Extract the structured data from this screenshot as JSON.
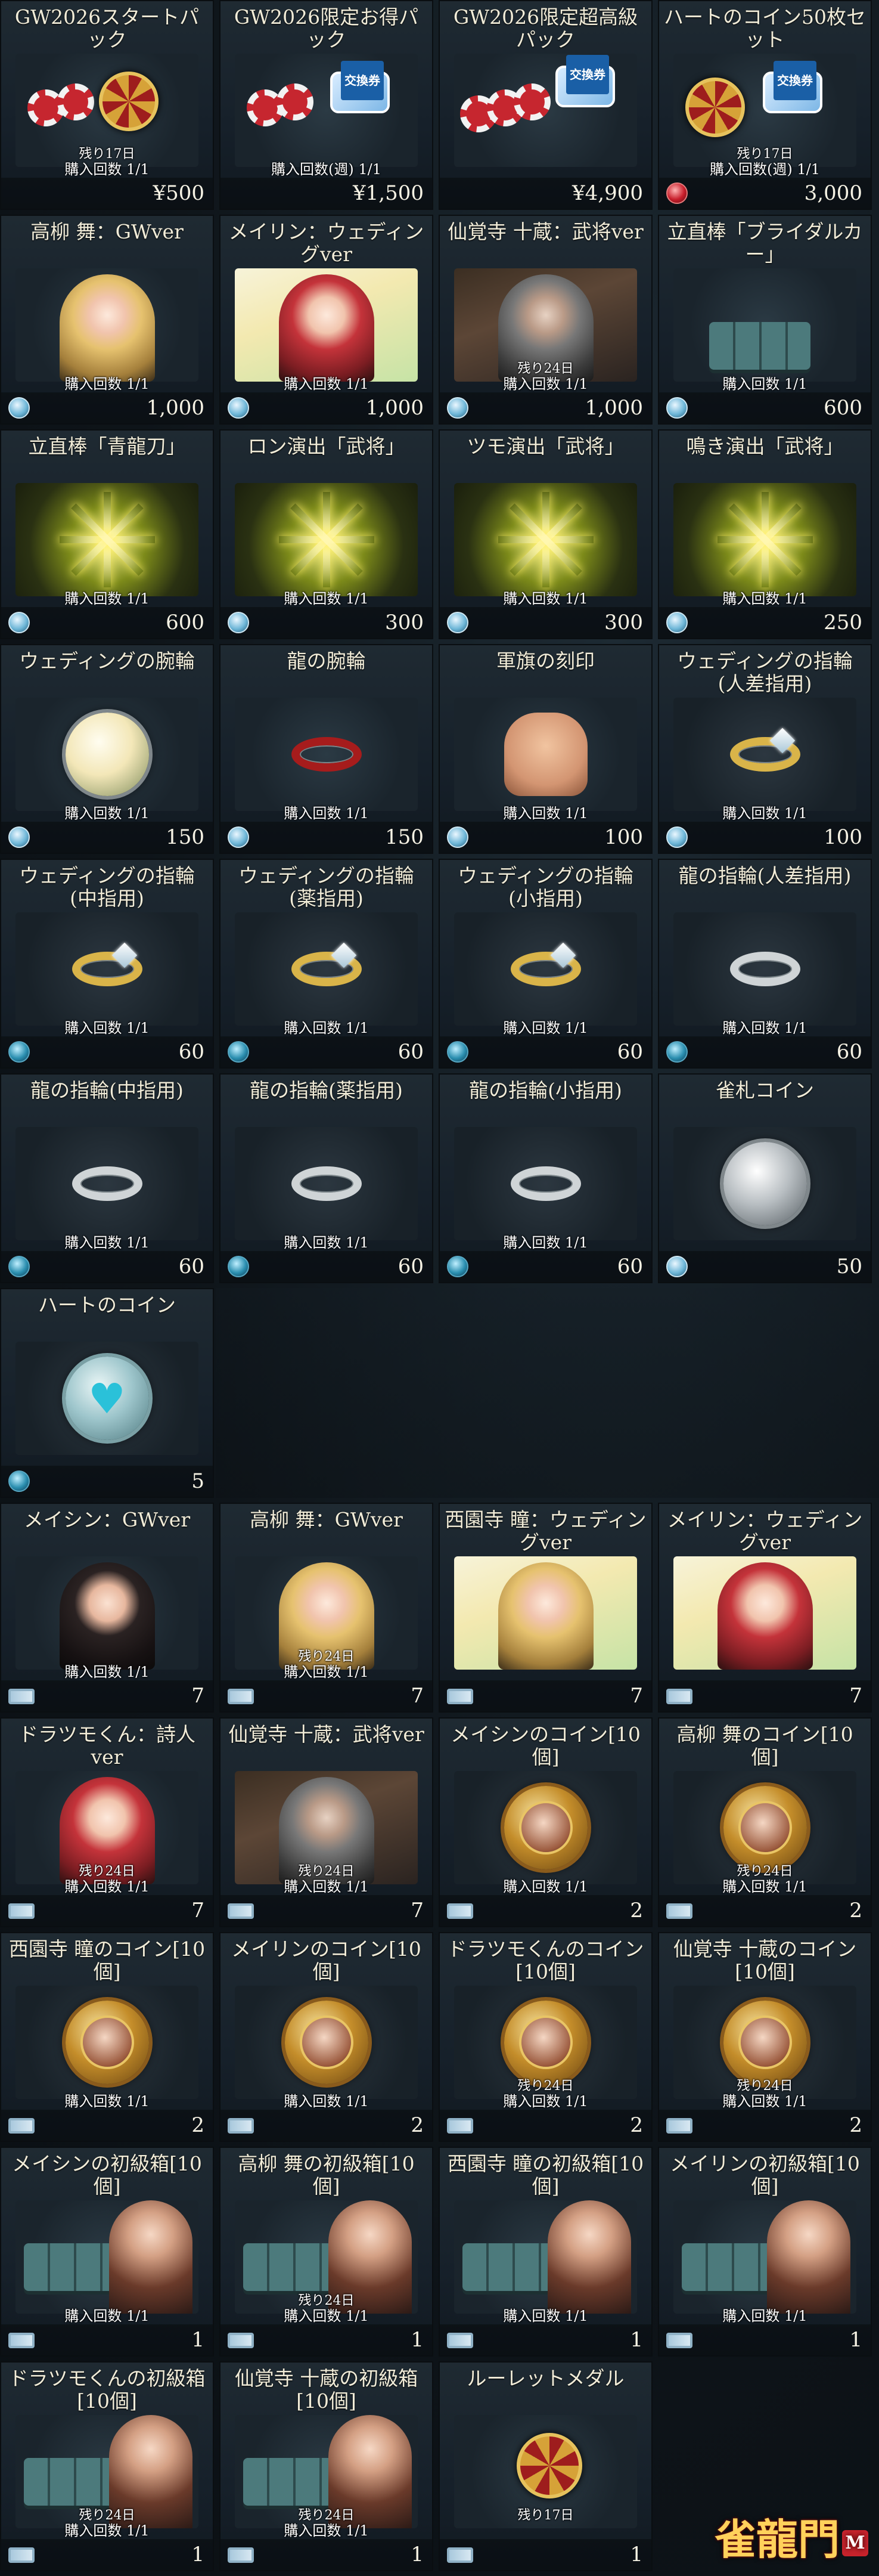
{
  "shop": {
    "cards": [
      {
        "title": "GW2026スタートパック",
        "art": "pack-start",
        "remain": "残り17日",
        "limit": "購入回数 1/1",
        "currency": "none",
        "price": "¥500"
      },
      {
        "title": "GW2026限定お得パック",
        "art": "pack-value",
        "remain": "",
        "limit": "購入回数(週) 1/1",
        "currency": "none",
        "price": "¥1,500"
      },
      {
        "title": "GW2026限定超高級パック",
        "art": "pack-premium",
        "remain": "",
        "limit": "",
        "currency": "none",
        "price": "¥4,900"
      },
      {
        "title": "ハートのコイン50枚セット",
        "art": "pack-heart",
        "remain": "残り17日",
        "limit": "購入回数(週) 1/1",
        "currency": "heart",
        "price": "3,000"
      },
      {
        "title": "高柳 舞：GWver",
        "art": "char-blonde",
        "remain": "",
        "limit": "購入回数 1/1",
        "currency": "ticket-coin",
        "price": "1,000"
      },
      {
        "title": "メイリン：ウェディングver",
        "art": "char-red-wedding",
        "remain": "",
        "limit": "購入回数 1/1",
        "currency": "ticket-coin",
        "price": "1,000"
      },
      {
        "title": "仙覚寺 十蔵：武将ver",
        "art": "char-gray",
        "remain": "残り24日",
        "limit": "購入回数 1/1",
        "currency": "ticket-coin",
        "price": "1,000"
      },
      {
        "title": "立直棒「ブライダルカー」",
        "art": "stick",
        "remain": "",
        "limit": "購入回数 1/1",
        "currency": "ticket-coin",
        "price": "600"
      },
      {
        "title": "立直棒「青龍刀」",
        "art": "effect",
        "remain": "",
        "limit": "購入回数 1/1",
        "currency": "ticket-coin",
        "price": "600"
      },
      {
        "title": "ロン演出「武将」",
        "art": "effect",
        "remain": "",
        "limit": "購入回数 1/1",
        "currency": "ticket-coin",
        "price": "300"
      },
      {
        "title": "ツモ演出「武将」",
        "art": "effect",
        "remain": "",
        "limit": "購入回数 1/1",
        "currency": "ticket-coin",
        "price": "300"
      },
      {
        "title": "鳴き演出「武将」",
        "art": "effect",
        "remain": "",
        "limit": "購入回数 1/1",
        "currency": "ticket-coin",
        "price": "250"
      },
      {
        "title": "ウェディングの腕輪",
        "art": "bouquet",
        "remain": "",
        "limit": "購入回数 1/1",
        "currency": "ticket-coin",
        "price": "150"
      },
      {
        "title": "龍の腕輪",
        "art": "bracelet",
        "remain": "",
        "limit": "購入回数 1/1",
        "currency": "ticket-coin",
        "price": "150"
      },
      {
        "title": "軍旗の刻印",
        "art": "hand",
        "remain": "",
        "limit": "購入回数 1/1",
        "currency": "ticket-coin",
        "price": "100"
      },
      {
        "title": "ウェディングの指輪(人差指用)",
        "art": "ring-gold",
        "remain": "",
        "limit": "購入回数 1/1",
        "currency": "ticket-coin",
        "price": "100"
      },
      {
        "title": "ウェディングの指輪(中指用)",
        "art": "ring-gold",
        "remain": "",
        "limit": "購入回数 1/1",
        "currency": "orb",
        "price": "60"
      },
      {
        "title": "ウェディングの指輪(薬指用)",
        "art": "ring-gold",
        "remain": "",
        "limit": "購入回数 1/1",
        "currency": "orb",
        "price": "60"
      },
      {
        "title": "ウェディングの指輪(小指用)",
        "art": "ring-gold",
        "remain": "",
        "limit": "購入回数 1/1",
        "currency": "orb",
        "price": "60"
      },
      {
        "title": "龍の指輪(人差指用)",
        "art": "ring-silver",
        "remain": "",
        "limit": "購入回数 1/1",
        "currency": "orb",
        "price": "60"
      },
      {
        "title": "龍の指輪(中指用)",
        "art": "ring-silver",
        "remain": "",
        "limit": "購入回数 1/1",
        "currency": "orb",
        "price": "60"
      },
      {
        "title": "龍の指輪(薬指用)",
        "art": "ring-silver",
        "remain": "",
        "limit": "購入回数 1/1",
        "currency": "orb",
        "price": "60"
      },
      {
        "title": "龍の指輪(小指用)",
        "art": "ring-silver",
        "remain": "",
        "limit": "購入回数 1/1",
        "currency": "orb",
        "price": "60"
      },
      {
        "title": "雀札コイン",
        "art": "coin-silver",
        "remain": "",
        "limit": "",
        "currency": "ticket-coin",
        "price": "50"
      },
      {
        "title": "ハートのコイン",
        "art": "coin-heart",
        "remain": "",
        "limit": "",
        "currency": "orb",
        "price": "5"
      }
    ],
    "ticket_cards": [
      {
        "title": "メイシン：GWver",
        "art": "char-dark",
        "remain": "",
        "limit": "購入回数 1/1",
        "price": "7"
      },
      {
        "title": "高柳 舞：GWver",
        "art": "char-blonde",
        "remain": "残り24日",
        "limit": "購入回数 1/1",
        "price": "7"
      },
      {
        "title": "西園寺 瞳：ウェディングver",
        "art": "char-blonde-wedding",
        "remain": "",
        "limit": "",
        "price": "7"
      },
      {
        "title": "メイリン：ウェディングver",
        "art": "char-red-wedding",
        "remain": "",
        "limit": "",
        "price": "7"
      },
      {
        "title": "ドラツモくん：詩人ver",
        "art": "char-red",
        "remain": "残り24日",
        "limit": "購入回数 1/1",
        "price": "7"
      },
      {
        "title": "仙覚寺 十蔵：武将ver",
        "art": "char-gray",
        "remain": "残り24日",
        "limit": "購入回数 1/1",
        "price": "7"
      },
      {
        "title": "メイシンのコイン[10個]",
        "art": "coin-portrait",
        "remain": "",
        "limit": "購入回数 1/1",
        "price": "2"
      },
      {
        "title": "高柳 舞のコイン[10個]",
        "art": "coin-portrait",
        "remain": "残り24日",
        "limit": "購入回数 1/1",
        "price": "2"
      },
      {
        "title": "西園寺 瞳のコイン[10個]",
        "art": "coin-portrait",
        "remain": "",
        "limit": "購入回数 1/1",
        "price": "2"
      },
      {
        "title": "メイリンのコイン[10個]",
        "art": "coin-portrait",
        "remain": "",
        "limit": "購入回数 1/1",
        "price": "2"
      },
      {
        "title": "ドラツモくんのコイン[10個]",
        "art": "coin-portrait",
        "remain": "残り24日",
        "limit": "購入回数 1/1",
        "price": "2"
      },
      {
        "title": "仙覚寺 十蔵のコイン[10個]",
        "art": "coin-portrait",
        "remain": "残り24日",
        "limit": "購入回数 1/1",
        "price": "2"
      },
      {
        "title": "メイシンの初級箱[10個]",
        "art": "box",
        "remain": "",
        "limit": "購入回数 1/1",
        "price": "1"
      },
      {
        "title": "高柳 舞の初級箱[10個]",
        "art": "box",
        "remain": "残り24日",
        "limit": "購入回数 1/1",
        "price": "1"
      },
      {
        "title": "西園寺 瞳の初級箱[10個]",
        "art": "box",
        "remain": "",
        "limit": "購入回数 1/1",
        "price": "1"
      },
      {
        "title": "メイリンの初級箱[10個]",
        "art": "box",
        "remain": "",
        "limit": "購入回数 1/1",
        "price": "1"
      },
      {
        "title": "ドラツモくんの初級箱[10個]",
        "art": "box",
        "remain": "残り24日",
        "limit": "購入回数 1/1",
        "price": "1"
      },
      {
        "title": "仙覚寺 十蔵の初級箱[10個]",
        "art": "box",
        "remain": "残り24日",
        "limit": "購入回数 1/1",
        "price": "1"
      },
      {
        "title": "ルーレットメダル",
        "art": "roulette",
        "remain": "残り17日",
        "limit": "",
        "price": "1"
      }
    ],
    "logo": {
      "text": "雀龍門",
      "badge": "M"
    }
  }
}
